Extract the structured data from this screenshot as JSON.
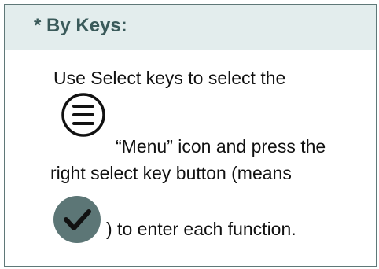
{
  "section": {
    "heading": "* By Keys:",
    "lines": [
      "Use Select keys to select the",
      "“Menu” icon and press the",
      "right select key button (means",
      ") to enter each function."
    ]
  },
  "icons": {
    "menu": "menu-icon",
    "check": "check-icon"
  },
  "colors": {
    "heading_text": "#3a5a5a",
    "header_background": "#e3eded",
    "border": "#5f7878",
    "check_background": "#5c7676"
  }
}
